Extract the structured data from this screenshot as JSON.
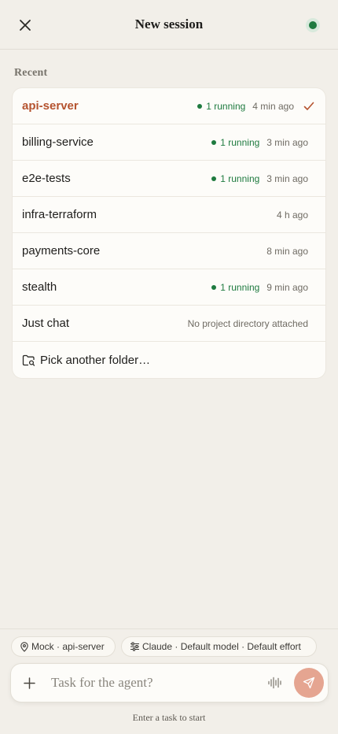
{
  "header": {
    "title": "New session"
  },
  "recent": {
    "label": "Recent",
    "items": [
      {
        "name": "api-server",
        "running": "1 running",
        "time": "4 min ago",
        "selected": true
      },
      {
        "name": "billing-service",
        "running": "1 running",
        "time": "3 min ago"
      },
      {
        "name": "e2e-tests",
        "running": "1 running",
        "time": "3 min ago"
      },
      {
        "name": "infra-terraform",
        "time": "4 h ago"
      },
      {
        "name": "payments-core",
        "time": "8 min ago"
      },
      {
        "name": "stealth",
        "running": "1 running",
        "time": "9 min ago"
      },
      {
        "name": "Just chat",
        "time": "No project directory attached"
      }
    ],
    "pick_folder": "Pick another folder…"
  },
  "chips": {
    "project": "Mock · api-server",
    "model": "Claude · Default model · Default effort"
  },
  "composer": {
    "placeholder": "Task for the agent?",
    "hint": "Enter a task to start"
  },
  "colors": {
    "accent": "#b5532f",
    "running_green": "#1e7a3f",
    "send_button": "#e5a591",
    "background": "#f2efe9"
  },
  "icons": {
    "close": "close-icon",
    "status": "status-dot-icon",
    "check": "check-icon",
    "folder": "folder-search-icon",
    "location": "map-pin-icon",
    "sliders": "sliders-icon",
    "plus": "plus-icon",
    "voice": "waveform-icon",
    "send": "send-icon"
  }
}
